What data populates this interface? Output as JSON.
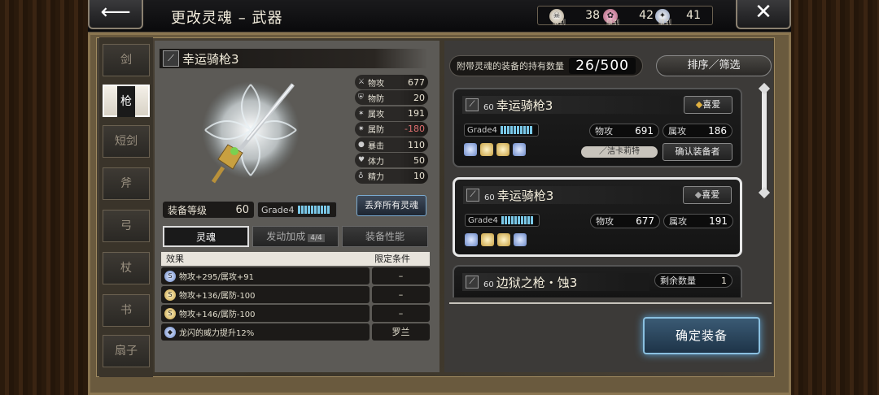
{
  "header": {
    "title": "更改灵魂 – 武器",
    "back_icon": "arrow-left-icon",
    "close_icon": "close-icon",
    "currencies": [
      {
        "icon": "skull-emblem-icon",
        "level_label": "级别",
        "value": "38"
      },
      {
        "icon": "rose-emblem-icon",
        "level_label": "级别",
        "value": "42"
      },
      {
        "icon": "angel-emblem-icon",
        "level_label": "级别",
        "value": "41"
      }
    ]
  },
  "categories": [
    {
      "label": "剑",
      "active": false
    },
    {
      "label": "枪",
      "active": true
    },
    {
      "label": "短剑",
      "active": false
    },
    {
      "label": "斧",
      "active": false
    },
    {
      "label": "弓",
      "active": false
    },
    {
      "label": "杖",
      "active": false
    },
    {
      "label": "书",
      "active": false
    },
    {
      "label": "扇子",
      "active": false
    }
  ],
  "weapon": {
    "name": "幸运骑枪3",
    "stats": [
      {
        "label": "物攻",
        "value": "677",
        "icon": "physical-attack-icon",
        "negative": false
      },
      {
        "label": "物防",
        "value": "20",
        "icon": "physical-defense-icon",
        "negative": false
      },
      {
        "label": "属攻",
        "value": "191",
        "icon": "elemental-attack-icon",
        "negative": false
      },
      {
        "label": "属防",
        "value": "-180",
        "icon": "elemental-defense-icon",
        "negative": true
      },
      {
        "label": "暴击",
        "value": "110",
        "icon": "critical-icon",
        "negative": false
      },
      {
        "label": "体力",
        "value": "50",
        "icon": "heart-icon",
        "negative": false
      },
      {
        "label": "精力",
        "value": "10",
        "icon": "mana-icon",
        "negative": false
      }
    ],
    "level_label": "装备等级",
    "level_value": "60",
    "grade_label": "Grade",
    "grade_value": "4",
    "discard_label": "丢弃所有灵魂"
  },
  "subtabs": {
    "soul": "灵魂",
    "bonus": "发动加成",
    "bonus_count": "4/4",
    "performance": "装备性能"
  },
  "effects": {
    "col_effect": "效果",
    "col_condition": "限定条件",
    "rows": [
      {
        "gem": "b",
        "gem_label": "S",
        "text": "物攻+295/属攻+91",
        "condition": "–"
      },
      {
        "gem": "y",
        "gem_label": "S",
        "text": "物攻+136/属防-100",
        "condition": "–"
      },
      {
        "gem": "y",
        "gem_label": "S",
        "text": "物攻+146/属防-100",
        "condition": "–"
      },
      {
        "gem": "b",
        "gem_label": "◆",
        "text": "龙闪的威力提升12%",
        "condition": "罗兰"
      }
    ]
  },
  "inventory": {
    "count_label": "附带灵魂的装备的持有数量",
    "count_value": "26/500",
    "sort_label": "排序／筛选",
    "cards": [
      {
        "level": "60",
        "name": "幸运骑枪3",
        "fav": "喜爱",
        "grade": "4",
        "patk_label": "物攻",
        "patk": "691",
        "eatk_label": "属攻",
        "eatk": "186",
        "owner": "／洁卡莉特",
        "confirm": "确认装备者"
      },
      {
        "level": "60",
        "name": "幸运骑枪3",
        "fav": "喜爱",
        "grade": "4",
        "patk_label": "物攻",
        "patk": "677",
        "eatk_label": "属攻",
        "eatk": "191"
      },
      {
        "level": "60",
        "name": "边狱之枪・蚀3",
        "remain_label": "剩余数量",
        "remain": "1"
      }
    ],
    "equip_label": "确定装备"
  },
  "colors": {
    "accent_blue": "#7ac8e8",
    "negative_red": "#e07070",
    "favorite_gold": "#e0b040"
  }
}
